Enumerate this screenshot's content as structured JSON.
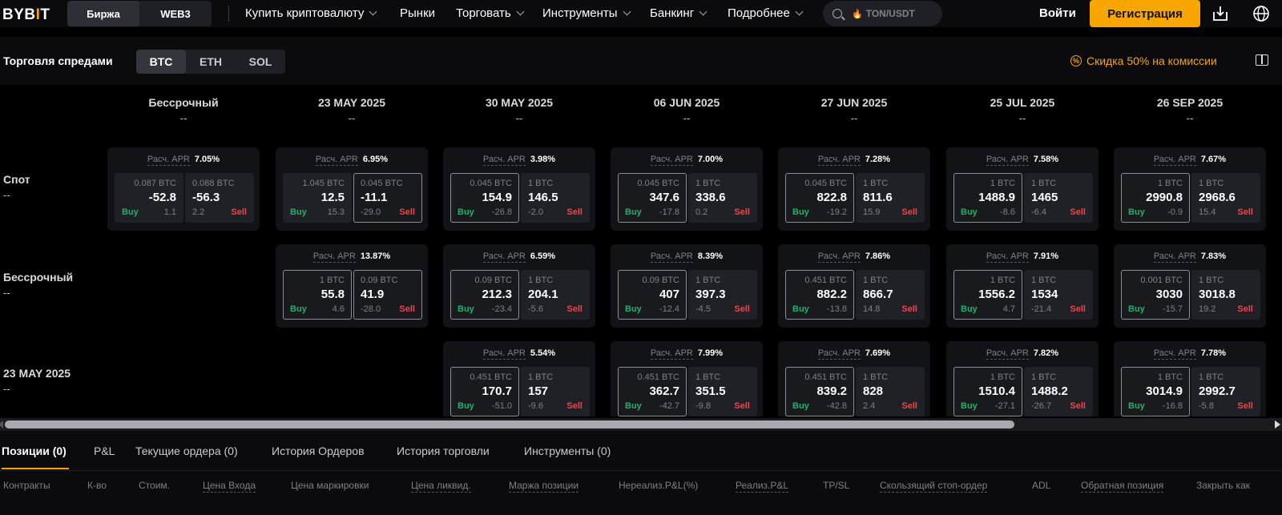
{
  "header": {
    "logo": "BYBIT",
    "segments": [
      "Биржа",
      "WEB3"
    ],
    "nav": [
      "Купить криптовалюту",
      "Рынки",
      "Торговать",
      "Инструменты",
      "Банкинг",
      "Подробнее"
    ],
    "search_placeholder": "TON/USDT",
    "login": "Войти",
    "register": "Регистрация"
  },
  "subheader": {
    "title": "Торговля спредами",
    "coins": [
      "BTC",
      "ETH",
      "SOL"
    ],
    "promo": "Скидка 50% на комиссии"
  },
  "grid": {
    "apr_label": "Расч. APR",
    "buy_label": "Buy",
    "sell_label": "Sell",
    "columns": [
      {
        "date": "Бессрочный",
        "sub": "--"
      },
      {
        "date": "23 MAY 2025",
        "sub": "--"
      },
      {
        "date": "30 MAY 2025",
        "sub": "--"
      },
      {
        "date": "06 JUN 2025",
        "sub": "--"
      },
      {
        "date": "27 JUN 2025",
        "sub": "--"
      },
      {
        "date": "25 JUL 2025",
        "sub": "--"
      },
      {
        "date": "26 SEP 2025",
        "sub": "--"
      }
    ],
    "rows": [
      {
        "name": "Спот",
        "sub": "--",
        "cells": [
          {
            "apr": "7.05%",
            "bq": "0.087 BTC",
            "bp": "-52.8",
            "bc": "1.1",
            "sq": "0.088 BTC",
            "sp": "-56.3",
            "sc": "2.2"
          },
          {
            "apr": "6.95%",
            "bq": "1.045 BTC",
            "bp": "12.5",
            "bc": "15.3",
            "sq": "0.045 BTC",
            "sp": "-11.1",
            "sc": "-29.0"
          },
          {
            "apr": "3.98%",
            "bq": "0.045 BTC",
            "bp": "154.9",
            "bc": "-26.8",
            "sq": "1 BTC",
            "sp": "146.5",
            "sc": "-2.0"
          },
          {
            "apr": "7.00%",
            "bq": "0.045 BTC",
            "bp": "347.6",
            "bc": "-17.8",
            "sq": "1 BTC",
            "sp": "338.6",
            "sc": "0.2"
          },
          {
            "apr": "7.28%",
            "bq": "0.045 BTC",
            "bp": "822.8",
            "bc": "-19.2",
            "sq": "1 BTC",
            "sp": "811.6",
            "sc": "15.9"
          },
          {
            "apr": "7.58%",
            "bq": "1 BTC",
            "bp": "1488.9",
            "bc": "-8.6",
            "sq": "1 BTC",
            "sp": "1465",
            "sc": "-6.4"
          },
          {
            "apr": "7.67%",
            "bq": "1 BTC",
            "bp": "2990.8",
            "bc": "-0.9",
            "sq": "1 BTC",
            "sp": "2968.6",
            "sc": "15.4"
          }
        ]
      },
      {
        "name": "Бессрочный",
        "sub": "--",
        "cells": [
          null,
          {
            "apr": "13.87%",
            "bq": "1 BTC",
            "bp": "55.8",
            "bc": "4.6",
            "sq": "0.09 BTC",
            "sp": "41.9",
            "sc": "-28.0"
          },
          {
            "apr": "6.59%",
            "bq": "0.09 BTC",
            "bp": "212.3",
            "bc": "-23.4",
            "sq": "1 BTC",
            "sp": "204.1",
            "sc": "-5.6"
          },
          {
            "apr": "8.39%",
            "bq": "0.09 BTC",
            "bp": "407",
            "bc": "-12.4",
            "sq": "1 BTC",
            "sp": "397.3",
            "sc": "-4.5"
          },
          {
            "apr": "7.86%",
            "bq": "0.451 BTC",
            "bp": "882.2",
            "bc": "-13.8",
            "sq": "1 BTC",
            "sp": "866.7",
            "sc": "14.8"
          },
          {
            "apr": "7.91%",
            "bq": "1 BTC",
            "bp": "1556.2",
            "bc": "4.7",
            "sq": "1 BTC",
            "sp": "1534",
            "sc": "-21.4"
          },
          {
            "apr": "7.83%",
            "bq": "0.001 BTC",
            "bp": "3030",
            "bc": "-15.7",
            "sq": "1 BTC",
            "sp": "3018.8",
            "sc": "19.2"
          }
        ]
      },
      {
        "name": "23 MAY 2025",
        "sub": "--",
        "cells": [
          null,
          null,
          {
            "apr": "5.54%",
            "bq": "0.451 BTC",
            "bp": "170.7",
            "bc": "-51.0",
            "sq": "1 BTC",
            "sp": "157",
            "sc": "-9.6"
          },
          {
            "apr": "7.99%",
            "bq": "0.451 BTC",
            "bp": "362.7",
            "bc": "-42.7",
            "sq": "1 BTC",
            "sp": "351.5",
            "sc": "-9.8"
          },
          {
            "apr": "7.69%",
            "bq": "0.451 BTC",
            "bp": "839.2",
            "bc": "-42.8",
            "sq": "1 BTC",
            "sp": "828",
            "sc": "2.4"
          },
          {
            "apr": "7.82%",
            "bq": "1 BTC",
            "bp": "1510.4",
            "bc": "-27.1",
            "sq": "1 BTC",
            "sp": "1488.2",
            "sc": "-26.7"
          },
          {
            "apr": "7.78%",
            "bq": "1 BTC",
            "bp": "3014.9",
            "bc": "-16.8",
            "sq": "1 BTC",
            "sp": "2992.7",
            "sc": "-5.8"
          }
        ]
      }
    ]
  },
  "bottom": {
    "tabs": [
      "Позиции (0)",
      "P&L",
      "Текущие ордера (0)",
      "История Ордеров",
      "История торговли",
      "Инструменты (0)"
    ],
    "columns": [
      "Контракты",
      "К-во",
      "Стоим.",
      "Цена Входа",
      "Цена маркировки",
      "Цена ликвид.",
      "Маржа позиции",
      "Нереализ.P&L(%)",
      "Реализ.P&L",
      "TP/SL",
      "Скользящий стоп-ордер",
      "ADL",
      "Обратная позиция",
      "Закрыть как"
    ]
  }
}
